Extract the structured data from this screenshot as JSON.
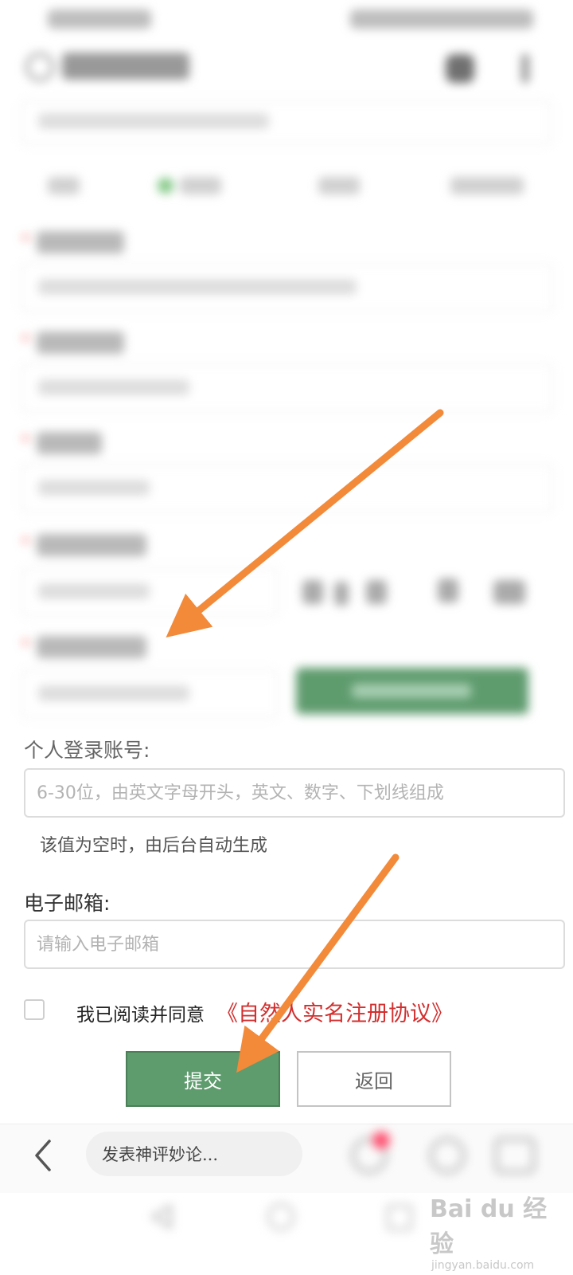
{
  "form": {
    "login_account": {
      "label": "个人登录账号:",
      "placeholder": "6-30位，由英文字母开头，英文、数字、下划线组成",
      "hint": "该值为空时，由后台自动生成"
    },
    "email": {
      "label": "电子邮箱:",
      "placeholder": "请输入电子邮箱"
    },
    "agreement": {
      "text": "我已阅读并同意",
      "link": "《自然人实名注册协议》"
    },
    "submit_label": "提交",
    "back_label": "返回"
  },
  "bottom_bar": {
    "comment_placeholder": "发表神评妙论..."
  },
  "watermark": {
    "brand": "Bai du 经验",
    "url": "jingyan.baidu.com"
  },
  "colors": {
    "accent_green": "#5e9b6d",
    "link_red": "#d32f2f",
    "arrow_orange": "#f28a3a"
  }
}
